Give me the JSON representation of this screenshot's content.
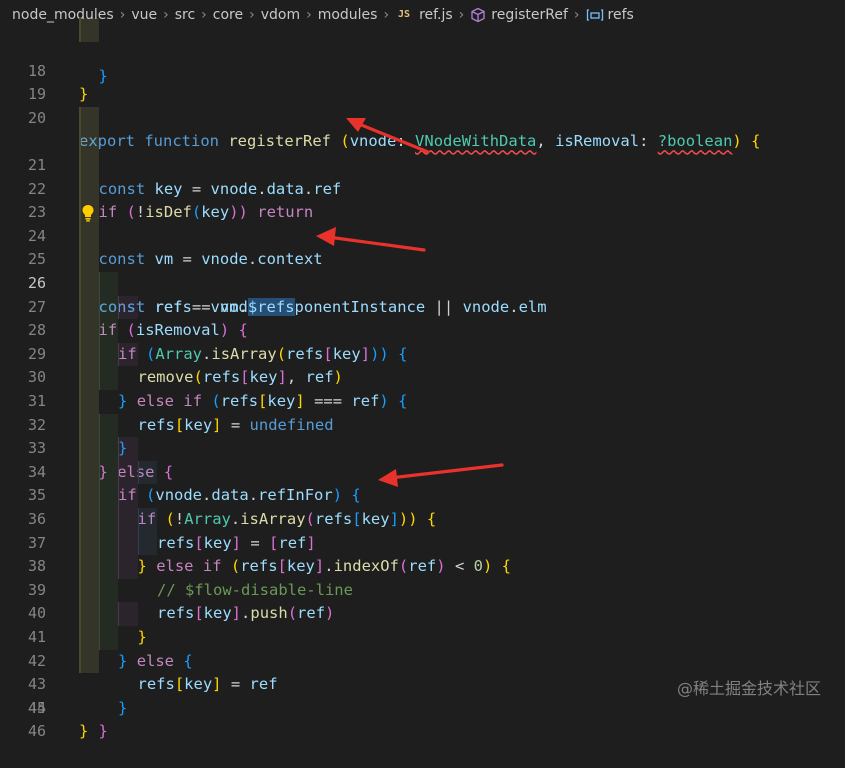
{
  "breadcrumb": {
    "items": [
      "node_modules",
      "vue",
      "src",
      "core",
      "vdom",
      "modules",
      "ref.js",
      "registerRef",
      "refs"
    ],
    "file_icon_text": "JS"
  },
  "lines": {
    "l18": {
      "num": "18",
      "t1": "}"
    },
    "l19": {
      "num": "19"
    },
    "l20": {
      "num": "20",
      "t1": "export",
      "t2": "function",
      "t3": "registerRef",
      "t4": "(",
      "t5": "vnode",
      "t6": ":",
      "t7": "VNodeWithData",
      "t8": ",",
      "t9": "isRemoval",
      "t10": ":",
      "t11": "?boolean",
      "t12": ")",
      "t13": "{"
    },
    "l21": {
      "num": "21",
      "t1": "const",
      "t2": "key",
      "t3": "=",
      "t4": "vnode",
      "t5": ".",
      "t6": "data",
      "t7": ".",
      "t8": "ref"
    },
    "l22": {
      "num": "22",
      "t1": "if",
      "t2": "(",
      "t3": "!",
      "t4": "isDef",
      "t5": "(",
      "t6": "key",
      "t7": "))",
      "t8": "return"
    },
    "l23": {
      "num": "23"
    },
    "l24": {
      "num": "24",
      "t1": "const",
      "t2": "vm",
      "t3": "=",
      "t4": "vnode",
      "t5": ".",
      "t6": "context"
    },
    "l25": {
      "num": "25",
      "t1": "const",
      "t2": "ref",
      "t3": "=",
      "t4": "vnode",
      "t5": ".",
      "t6": "componentInstance",
      "t7": "||",
      "t8": "vnode",
      "t9": ".",
      "t10": "elm"
    },
    "l26": {
      "num": "26",
      "t1": "const",
      "t2": "refs",
      "t3": "=",
      "t4": "vm",
      "t5": ".",
      "t6": "$refs"
    },
    "l27": {
      "num": "27",
      "t1": "if",
      "t2": "(",
      "t3": "isRemoval",
      "t4": ")",
      "t5": "{"
    },
    "l28": {
      "num": "28",
      "t1": "if",
      "t2": "(",
      "t3": "Array",
      "t4": ".",
      "t5": "isArray",
      "t6": "(",
      "t7": "refs",
      "t8": "[",
      "t9": "key",
      "t10": "]",
      "t11": "))",
      "t12": "{"
    },
    "l29": {
      "num": "29",
      "t1": "remove",
      "t2": "(",
      "t3": "refs",
      "t4": "[",
      "t5": "key",
      "t6": "]",
      "t7": ",",
      "t8": "ref",
      "t9": ")"
    },
    "l30": {
      "num": "30",
      "t1": "}",
      "t2": "else",
      "t3": "if",
      "t4": "(",
      "t5": "refs",
      "t6": "[",
      "t7": "key",
      "t8": "]",
      "t9": "===",
      "t10": "ref",
      "t11": ")",
      "t12": "{"
    },
    "l31": {
      "num": "31",
      "t1": "refs",
      "t2": "[",
      "t3": "key",
      "t4": "]",
      "t5": "=",
      "t6": "undefined"
    },
    "l32": {
      "num": "32",
      "t1": "}"
    },
    "l33": {
      "num": "33",
      "t1": "}",
      "t2": "else",
      "t3": "{"
    },
    "l34": {
      "num": "34",
      "t1": "if",
      "t2": "(",
      "t3": "vnode",
      "t4": ".",
      "t5": "data",
      "t6": ".",
      "t7": "refInFor",
      "t8": ")",
      "t9": "{"
    },
    "l35": {
      "num": "35",
      "t1": "if",
      "t2": "(",
      "t3": "!",
      "t4": "Array",
      "t5": ".",
      "t6": "isArray",
      "t7": "(",
      "t8": "refs",
      "t9": "[",
      "t10": "key",
      "t11": "]",
      "t12": "))",
      "t13": "{"
    },
    "l36": {
      "num": "36",
      "t1": "refs",
      "t2": "[",
      "t3": "key",
      "t4": "]",
      "t5": "=",
      "t6": "[",
      "t7": "ref",
      "t8": "]"
    },
    "l37": {
      "num": "37",
      "t1": "}",
      "t2": "else",
      "t3": "if",
      "t4": "(",
      "t5": "refs",
      "t6": "[",
      "t7": "key",
      "t8": "]",
      "t9": ".",
      "t10": "indexOf",
      "t11": "(",
      "t12": "ref",
      "t13": ")",
      "t14": "<",
      "t15": "0",
      "t16": ")",
      "t17": "{"
    },
    "l38": {
      "num": "38",
      "t1": "// $flow-disable-line"
    },
    "l39": {
      "num": "39",
      "t1": "refs",
      "t2": "[",
      "t3": "key",
      "t4": "]",
      "t5": ".",
      "t6": "push",
      "t7": "(",
      "t8": "ref",
      "t9": ")"
    },
    "l40": {
      "num": "40",
      "t1": "}"
    },
    "l41": {
      "num": "41",
      "t1": "}",
      "t2": "else",
      "t3": "{"
    },
    "l42": {
      "num": "42",
      "t1": "refs",
      "t2": "[",
      "t3": "key",
      "t4": "]",
      "t5": "=",
      "t6": "ref"
    },
    "l43": {
      "num": "43",
      "t1": "}"
    },
    "l44": {
      "num": "44",
      "t1": "}"
    },
    "l45": {
      "num": "45",
      "t1": "}"
    },
    "l46": {
      "num": "46"
    }
  },
  "watermark": "@稀土掘金技术社区",
  "colors": {
    "background": "#1e1e1e",
    "keyword": "#569cd6",
    "control": "#c586c0",
    "function": "#dcdcaa",
    "variable": "#9cdcfe",
    "type": "#4ec9b0",
    "arrow": "#e8322b"
  }
}
